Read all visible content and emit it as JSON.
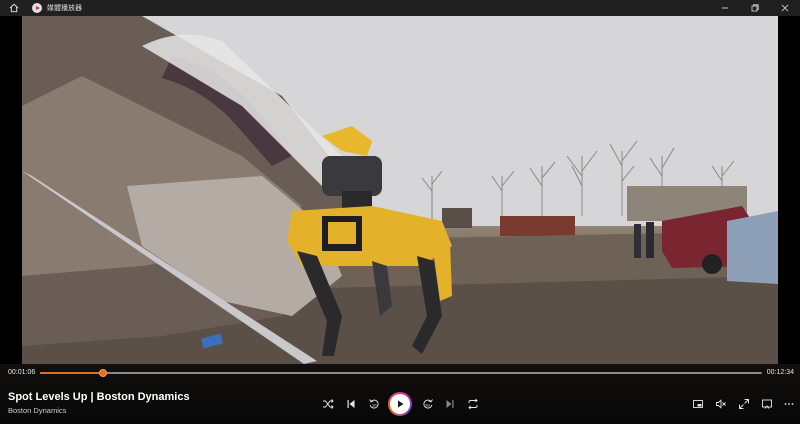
{
  "app": {
    "title": "媒體播放器",
    "icon": "media-player-logo-icon"
  },
  "window_controls": [
    "minimize-icon",
    "restore-icon",
    "close-icon"
  ],
  "video": {
    "description_icon": "video-frame"
  },
  "playback": {
    "current_time": "00:01:06",
    "total_time": "00:12:34",
    "progress": 0.0875
  },
  "media": {
    "title": "Spot Levels Up | Boston Dynamics",
    "artist": "Boston Dynamics"
  },
  "transport_icons": [
    "shuffle-icon",
    "previous-icon",
    "rewind-10-icon",
    "play-icon",
    "forward-30-icon",
    "next-icon",
    "repeat-icon"
  ],
  "right_icons": [
    "miniplayer-icon",
    "volume-mute-icon",
    "fullscreen-icon",
    "cast-icon",
    "more-options-icon"
  ],
  "colors": {
    "accent": "#e0701e",
    "titlebar": "#202020",
    "background": "#000000"
  }
}
